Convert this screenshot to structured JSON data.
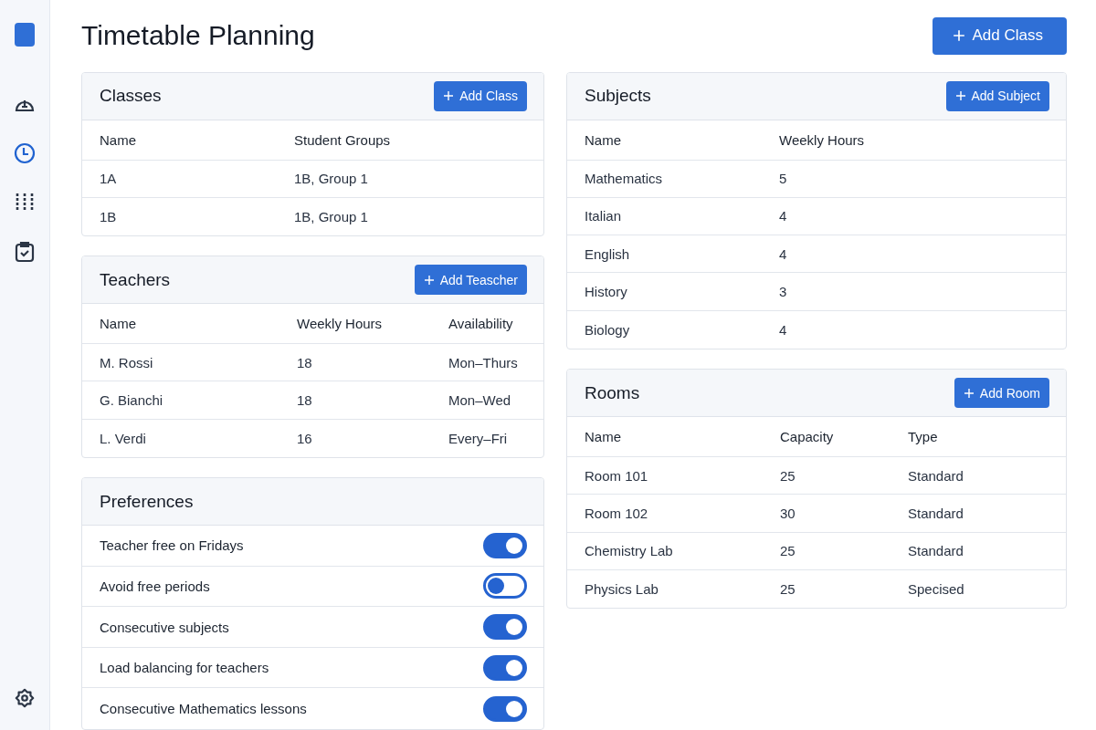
{
  "sidebar": {
    "items": [
      {
        "kind": "gauge",
        "selected": false
      },
      {
        "kind": "clock",
        "selected": true
      },
      {
        "kind": "columns",
        "selected": false
      },
      {
        "kind": "clipboard",
        "selected": false
      }
    ]
  },
  "title": "Timetable Planning",
  "primary_button": "Add Class",
  "classes": {
    "title": "Classes",
    "button": "Add Class",
    "columns": [
      "Name",
      "Student Groups"
    ],
    "rows": [
      [
        "1A",
        "1B, Group 1"
      ],
      [
        "1B",
        "1B, Group 1"
      ]
    ]
  },
  "teachers": {
    "title": "Teachers",
    "button": "Add Teascher",
    "columns": [
      "Name",
      "Weekly Hours",
      "Availability"
    ],
    "rows": [
      [
        "M. Rossi",
        "18",
        "Mon–Thurs"
      ],
      [
        "G. Bianchi",
        "18",
        "Mon–Wed"
      ],
      [
        "L. Verdi",
        "16",
        "Every–Fri"
      ]
    ]
  },
  "preferences": {
    "title": "Preferences",
    "items": [
      {
        "label": "Teacher free on Fridays",
        "on": true
      },
      {
        "label": "Avoid free periods",
        "on": false
      },
      {
        "label": "Consecutive subjects",
        "on": true
      },
      {
        "label": "Load balancing for teachers",
        "on": true
      },
      {
        "label": "Consecutive Mathematics lessons",
        "on": true
      }
    ]
  },
  "subjects": {
    "title": "Subjects",
    "button": "Add Subject",
    "columns": [
      "Name",
      "Weekly Hours"
    ],
    "rows": [
      [
        "Mathematics",
        "5"
      ],
      [
        "Italian",
        "4"
      ],
      [
        "English",
        "4"
      ],
      [
        "History",
        "3"
      ],
      [
        "Biology",
        "4"
      ]
    ]
  },
  "rooms": {
    "title": "Rooms",
    "button": "Add Room",
    "columns": [
      "Name",
      "Capacity",
      "Type"
    ],
    "rows": [
      [
        "Room 101",
        "25",
        "Standard"
      ],
      [
        "Room 102",
        "30",
        "Standard"
      ],
      [
        "Chemistry Lab",
        "25",
        "Standard"
      ],
      [
        "Physics Lab",
        "25",
        "Specised"
      ]
    ]
  }
}
